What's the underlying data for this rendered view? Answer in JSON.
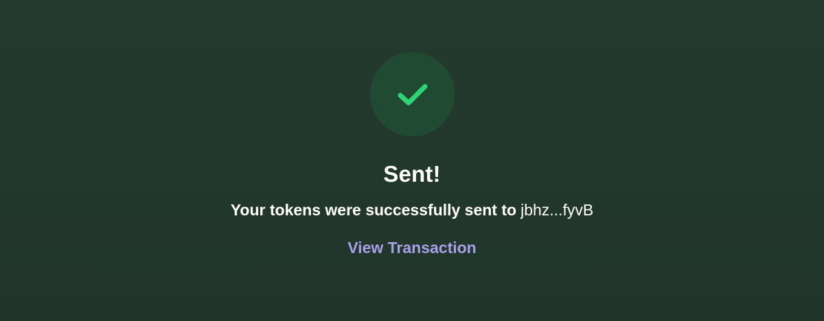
{
  "status": {
    "icon": "checkmark-icon",
    "icon_color": "#2fd574",
    "circle_color": "#214a32"
  },
  "title": "Sent!",
  "message": {
    "text": "Your tokens were successfully sent to",
    "recipient": "jbhz...fyvB"
  },
  "actions": {
    "view_transaction_label": "View Transaction",
    "link_color": "#a7a2e6"
  }
}
